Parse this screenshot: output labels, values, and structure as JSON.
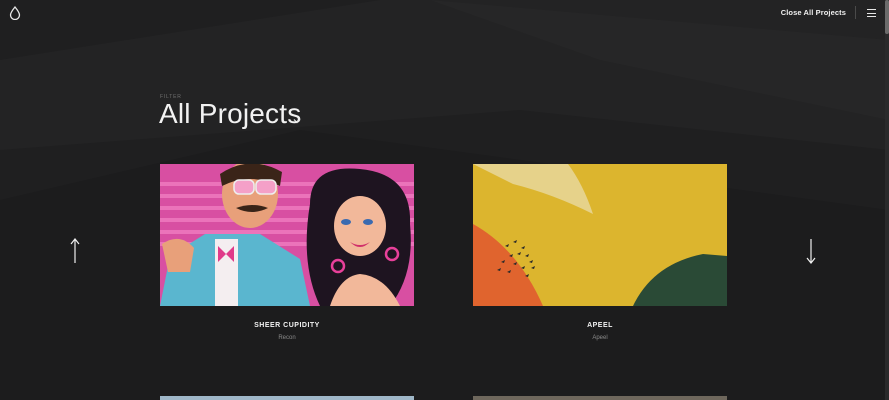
{
  "header": {
    "logo_icon": "drop-icon",
    "close_all_label": "Close All Projects",
    "menu_icon": "hamburger-icon"
  },
  "filter": {
    "label": "FILTER",
    "title": "All Projects",
    "chevron_icon": "chevron-down-icon"
  },
  "navigation": {
    "up_icon": "arrow-up-icon",
    "down_icon": "arrow-down-icon"
  },
  "projects": [
    {
      "title": "SHEER CUPIDITY",
      "subtitle": "Recon"
    },
    {
      "title": "APEEL",
      "subtitle": "Apeel"
    }
  ],
  "colors": {
    "background": "#1f1f20",
    "text": "#f2f2f2",
    "muted": "#8a8a8a"
  }
}
